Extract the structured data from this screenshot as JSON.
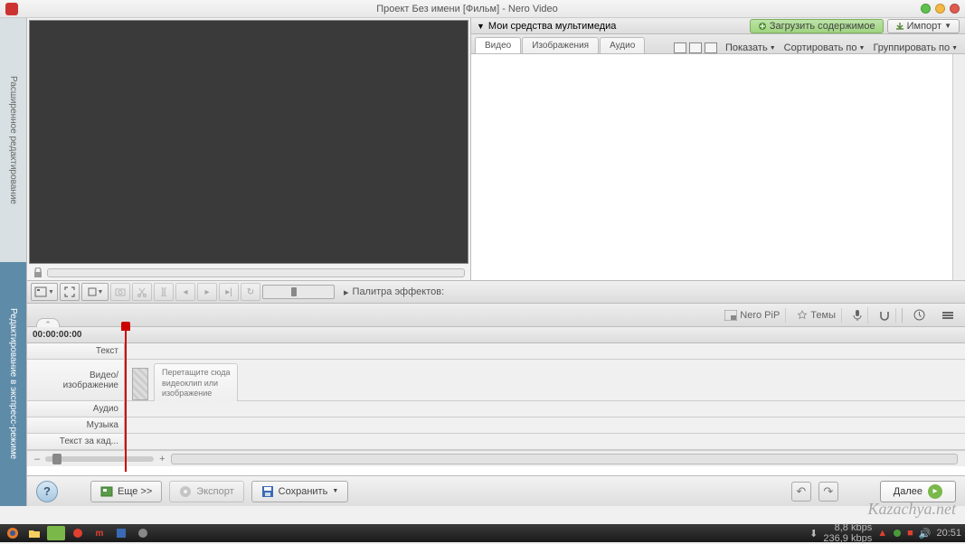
{
  "titlebar": {
    "title": "Проект Без имени [Фильм] - Nero Video"
  },
  "sidebar": {
    "top": "Расширенное редактирование",
    "bottom": "Редактирование в экспресс-режиме"
  },
  "media": {
    "header": "Мои средства мультимедиа",
    "load_btn": "Загрузить содержимое",
    "import_btn": "Импорт",
    "tabs": [
      "Видео",
      "Изображения",
      "Аудио"
    ],
    "show": "Показать",
    "sort": "Сортировать по",
    "group": "Группировать по"
  },
  "effects": {
    "header": "Палитра эффектов:",
    "nero_pip": "Nero PiP",
    "themes": "Темы"
  },
  "timeline": {
    "timecode": "00:00:00:00",
    "tracks": {
      "text": "Текст",
      "video": "Видео/\nизображение",
      "audio": "Аудио",
      "music": "Музыка",
      "caption": "Текст за кад..."
    },
    "hint": "Перетащите сюда\nвидеоклип или\nизображение"
  },
  "bottom": {
    "more": "Еще >>",
    "export": "Экспорт",
    "save": "Сохранить",
    "next": "Далее"
  },
  "status": {
    "down": "8,8 kbps",
    "up": "236,9 kbps",
    "time": "20:51"
  },
  "watermark": "Kazachya.net"
}
